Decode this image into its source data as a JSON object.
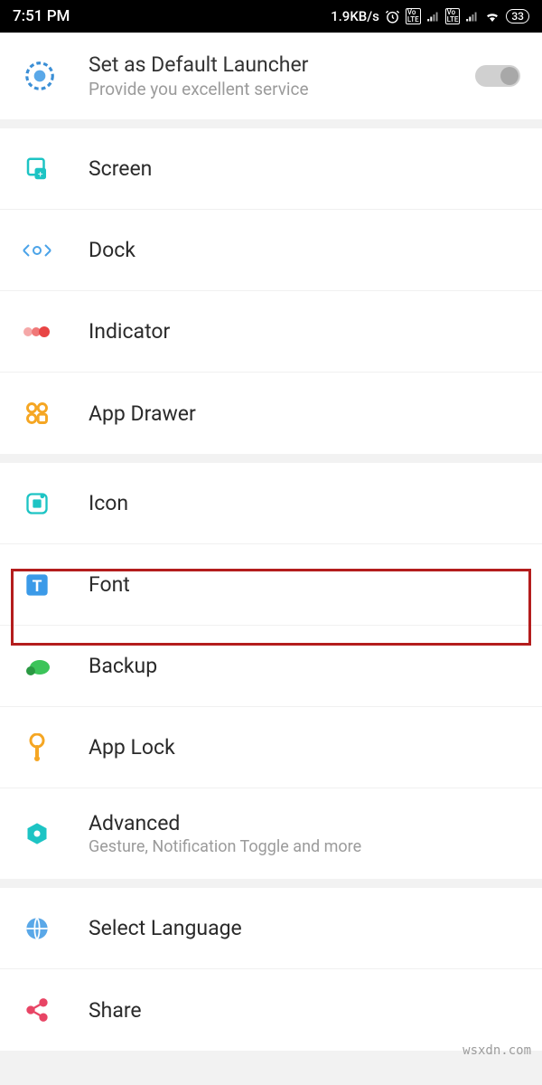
{
  "status": {
    "time": "7:51 PM",
    "speed": "1.9KB/s",
    "battery": "33"
  },
  "header": {
    "title": "Set as Default Launcher",
    "subtitle": "Provide you excellent service"
  },
  "menu": {
    "screen": "Screen",
    "dock": "Dock",
    "indicator": "Indicator",
    "appdrawer": "App Drawer",
    "icon": "Icon",
    "font": "Font",
    "backup": "Backup",
    "applock": "App Lock",
    "advanced": "Advanced",
    "advanced_sub": "Gesture, Notification Toggle and more",
    "lang": "Select Language",
    "share": "Share"
  },
  "watermark": "wsxdn.com"
}
